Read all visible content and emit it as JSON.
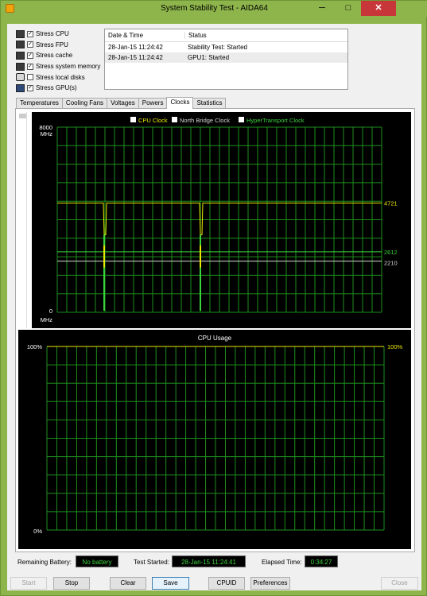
{
  "window": {
    "title": "System Stability Test - AIDA64",
    "min_glyph": "─",
    "max_glyph": "□",
    "close_glyph": "✕"
  },
  "stress": [
    {
      "label": "Stress CPU",
      "checked": true,
      "icon": "cpu-icon"
    },
    {
      "label": "Stress FPU",
      "checked": true,
      "icon": "fpu-icon"
    },
    {
      "label": "Stress cache",
      "checked": true,
      "icon": "cache-icon"
    },
    {
      "label": "Stress system memory",
      "checked": true,
      "icon": "memory-icon"
    },
    {
      "label": "Stress local disks",
      "checked": false,
      "icon": "disk-icon"
    },
    {
      "label": "Stress GPU(s)",
      "checked": true,
      "icon": "gpu-icon"
    }
  ],
  "log": {
    "headers": [
      "Date & Time",
      "Status"
    ],
    "rows": [
      [
        "28-Jan-15 11:24:42",
        "Stability Test: Started"
      ],
      [
        "28-Jan-15 11:24:42",
        "GPU1: Started"
      ]
    ]
  },
  "tabs": [
    "Temperatures",
    "Cooling Fans",
    "Voltages",
    "Powers",
    "Clocks",
    "Statistics"
  ],
  "active_tab": "Clocks",
  "chart_data": [
    {
      "type": "line",
      "title": "",
      "legend": [
        "CPU Clock",
        "North Bridge Clock",
        "HyperTransport Clock"
      ],
      "colors": {
        "CPU Clock": "#e8e800",
        "North Bridge Clock": "#d8d8d8",
        "HyperTransport Clock": "#3cd43c"
      },
      "ylim": [
        0,
        8000
      ],
      "ytop_label": "8000",
      "ytop_unit": "MHz",
      "ybottom_label": "0",
      "ybottom_unit": "MHz",
      "series": [
        {
          "name": "CPU Clock",
          "last": 4721,
          "last_label": "4721"
        },
        {
          "name": "North Bridge Clock",
          "last": 2210,
          "last_label": "2210"
        },
        {
          "name": "HyperTransport Clock",
          "last": 2612,
          "last_label": "2612"
        }
      ],
      "grid": true
    },
    {
      "type": "line",
      "title": "CPU Usage",
      "ylim": [
        0,
        100
      ],
      "ytop_label": "100%",
      "ybottom_label": "0%",
      "series": [
        {
          "name": "CPU Usage",
          "last": 100,
          "last_label": "100%"
        }
      ],
      "grid": true
    }
  ],
  "status": {
    "battery_label": "Remaining Battery:",
    "battery_value": "No battery",
    "started_label": "Test Started:",
    "started_value": "28-Jan-15 11:24:41",
    "elapsed_label": "Elapsed Time:",
    "elapsed_value": "0:34:27"
  },
  "buttons": {
    "start": "Start",
    "stop": "Stop",
    "clear": "Clear",
    "save": "Save",
    "cpuid": "CPUID",
    "preferences": "Preferences",
    "close": "Close"
  }
}
